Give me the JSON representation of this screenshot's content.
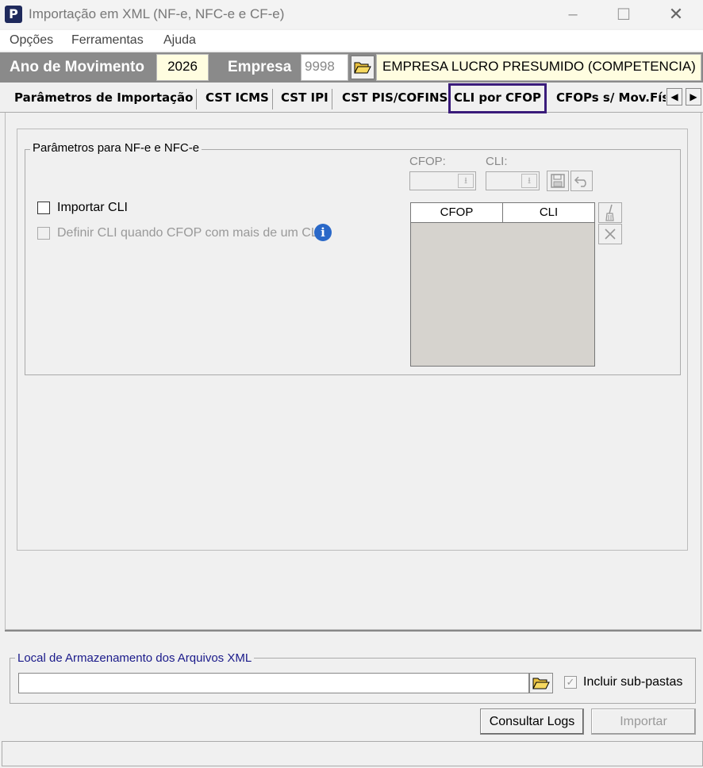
{
  "window": {
    "title": "Importação em XML (NF-e, NFC-e e CF-e)",
    "app_icon_letter": "P",
    "minimize": "–",
    "maximize": "☐",
    "close": "✕"
  },
  "menu": [
    "Opções",
    "Ferramentas",
    "Ajuda"
  ],
  "header": {
    "ano_label": "Ano de Movimento",
    "ano_value": "2026",
    "empresa_label": "Empresa",
    "empresa_code": "9998",
    "empresa_name": "EMPRESA LUCRO PRESUMIDO (COMPETENCIA)"
  },
  "tabs": [
    "Parâmetros de Importação",
    "CST ICMS",
    "CST IPI",
    "CST PIS/COFINS",
    "CLI por CFOP",
    "CFOPs s/ Mov.Fís"
  ],
  "active_tab": "CLI por CFOP",
  "group": {
    "legend": "Parâmetros para NF-e e NFC-e",
    "cfop_label": "CFOP:",
    "cli_label": "CLI:",
    "importar_cli_label": "Importar CLI",
    "importar_cli_checked": false,
    "definir_cli_label": "Definir CLI quando CFOP com mais de um CLI",
    "definir_cli_checked": false,
    "info_glyph": "i",
    "grid_columns": [
      "CFOP",
      "CLI"
    ]
  },
  "storage": {
    "legend": "Local de Armazenamento dos Arquivos XML",
    "path_value": "",
    "subfolders_label": "Incluir sub-pastas",
    "subfolders_checked": true
  },
  "buttons": {
    "consultar_logs": "Consultar Logs",
    "importar": "Importar"
  }
}
